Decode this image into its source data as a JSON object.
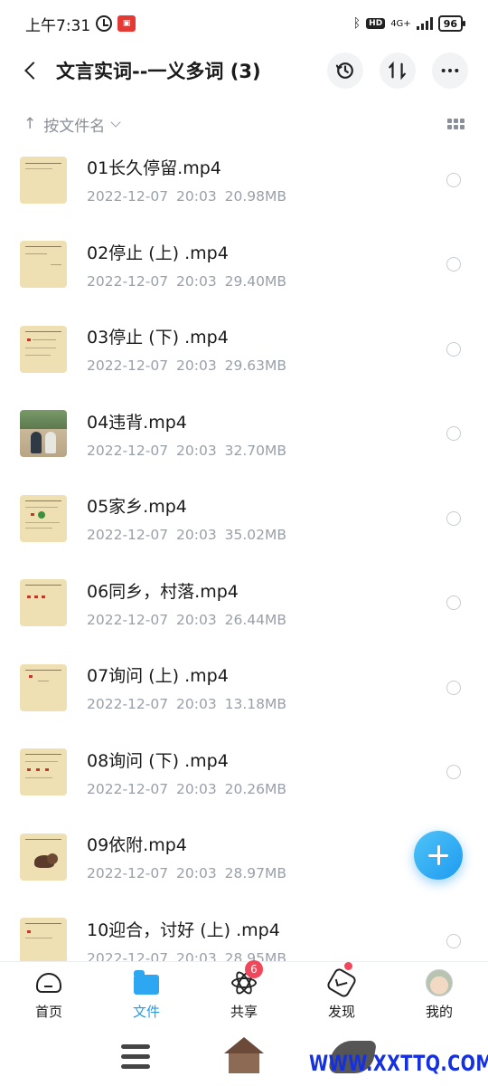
{
  "status_bar": {
    "time": "上午7:31",
    "hd": "HD",
    "network": "4G+",
    "battery": "96"
  },
  "header": {
    "title": "文言实词--一义多词 (3)"
  },
  "sort": {
    "label": "按文件名"
  },
  "files": [
    {
      "name": "01长久停留.mp4",
      "date": "2022-12-07",
      "time": "20:03",
      "size": "20.98MB"
    },
    {
      "name": "02停止 (上) .mp4",
      "date": "2022-12-07",
      "time": "20:03",
      "size": "29.40MB"
    },
    {
      "name": "03停止 (下) .mp4",
      "date": "2022-12-07",
      "time": "20:03",
      "size": "29.63MB"
    },
    {
      "name": "04违背.mp4",
      "date": "2022-12-07",
      "time": "20:03",
      "size": "32.70MB"
    },
    {
      "name": "05家乡.mp4",
      "date": "2022-12-07",
      "time": "20:03",
      "size": "35.02MB"
    },
    {
      "name": "06同乡，村落.mp4",
      "date": "2022-12-07",
      "time": "20:03",
      "size": "26.44MB"
    },
    {
      "name": "07询问 (上) .mp4",
      "date": "2022-12-07",
      "time": "20:03",
      "size": "13.18MB"
    },
    {
      "name": "08询问 (下) .mp4",
      "date": "2022-12-07",
      "time": "20:03",
      "size": "20.26MB"
    },
    {
      "name": "09依附.mp4",
      "date": "2022-12-07",
      "time": "20:03",
      "size": "28.97MB"
    },
    {
      "name": "10迎合，讨好 (上) .mp4",
      "date": "2022-12-07",
      "time": "20:03",
      "size": "28.95MB"
    }
  ],
  "nav": {
    "items": [
      {
        "label": "首页",
        "icon": "home-icon"
      },
      {
        "label": "文件",
        "icon": "folder-icon"
      },
      {
        "label": "共享",
        "icon": "atom-icon",
        "badge": "6"
      },
      {
        "label": "发现",
        "icon": "cube-icon"
      },
      {
        "label": "我的",
        "icon": "avatar"
      }
    ]
  },
  "watermark": "WWW.XXTTQ.COM",
  "colors": {
    "accent": "#1e9bf0",
    "badge": "#f0475a",
    "meta_text": "#9aa0aa"
  }
}
